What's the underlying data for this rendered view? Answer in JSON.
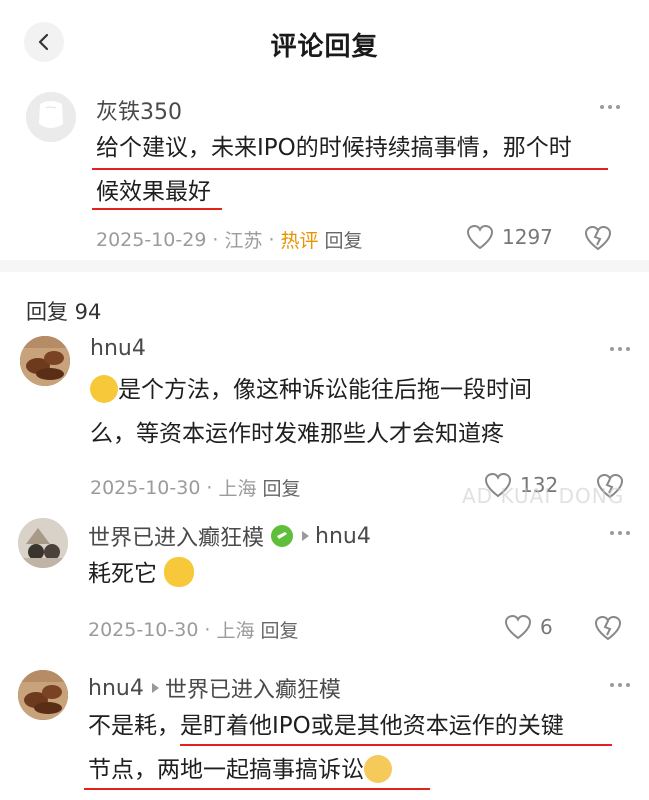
{
  "header": {
    "title": "评论回复"
  },
  "top_comment": {
    "username": "灰铁350",
    "text_line1": "给个建议，未来IPO的时候持续搞事情，那个时",
    "text_line2": "候效果最好",
    "date": "2025-10-29",
    "location": "江苏",
    "hot_label": "热评",
    "reply_label": "回复",
    "likes": "1297"
  },
  "replies_header": "回复 94",
  "replies": [
    {
      "username": "hnu4",
      "text_line1": "是个方法，像这种诉讼能往后拖一段时间",
      "text_line2": "么，等资本运作时发难那些人才会知道疼",
      "date": "2025-10-30",
      "location": "上海",
      "reply_label": "回复",
      "likes": "132"
    },
    {
      "username": "世界已进入癫狂模",
      "reply_to": "hnu4",
      "text_line1": "耗死它",
      "date": "2025-10-30",
      "location": "上海",
      "reply_label": "回复",
      "likes": "6"
    },
    {
      "username": "hnu4",
      "reply_to": "世界已进入癫狂模",
      "text_line1_a": "不是耗，",
      "text_line1_b": "是盯着他IPO或是其他资本运作的关键",
      "text_line2": "节点，两地一起搞事搞诉讼"
    }
  ],
  "watermark": "AD KUAI DONG",
  "colors": {
    "underline": "#e2231a",
    "hot": "#e89400",
    "meta": "#9b9b9b"
  }
}
